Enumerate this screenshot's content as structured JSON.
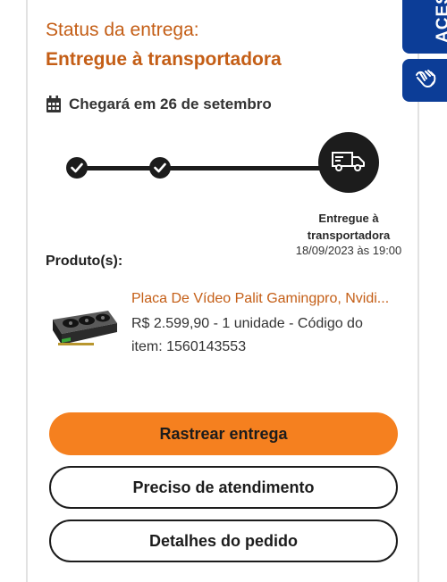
{
  "status": {
    "label": "Status da entrega:",
    "value": "Entregue à transportadora"
  },
  "eta": {
    "icon": "calendar-icon",
    "text": "Chegará em 26 de setembro"
  },
  "timeline": {
    "steps": [
      {
        "state": "done",
        "icon": "check-icon"
      },
      {
        "state": "done",
        "icon": "check-icon"
      },
      {
        "state": "current",
        "icon": "truck-icon"
      }
    ],
    "current_label": "Entregue à transportadora",
    "current_date": "18/09/2023 às 19:00"
  },
  "products": {
    "label": "Produto(s):",
    "items": [
      {
        "image": "graphics-card-image",
        "title": "Placa De Vídeo Palit Gamingpro, Nvidi...",
        "description": "R$ 2.599,90 - 1 unidade - Código do item: 1560143553"
      }
    ]
  },
  "buttons": {
    "track": "Rastrear entrega",
    "help": "Preciso de atendimento",
    "details": "Detalhes do pedido"
  },
  "accessibility": {
    "tab_text": "ACESS",
    "hands_icon": "sign-language-icon"
  },
  "colors": {
    "accent_orange": "#f5801f",
    "status_text": "#c45e16",
    "accessibility_blue": "#0c3d97",
    "timeline_dark": "#1c1c1c"
  }
}
